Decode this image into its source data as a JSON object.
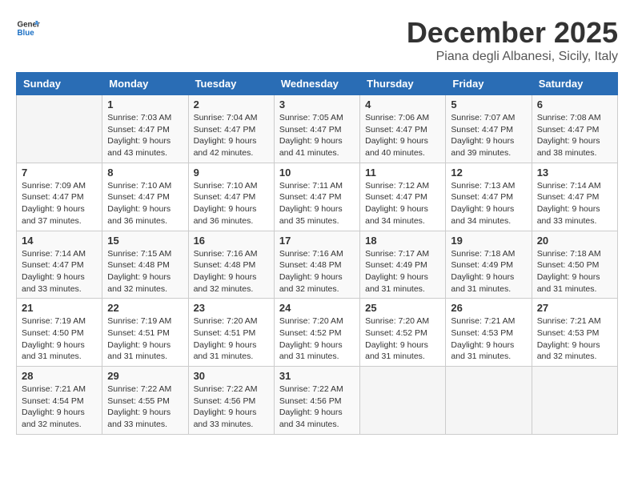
{
  "header": {
    "logo_line1": "General",
    "logo_line2": "Blue",
    "month_year": "December 2025",
    "location": "Piana degli Albanesi, Sicily, Italy"
  },
  "weekdays": [
    "Sunday",
    "Monday",
    "Tuesday",
    "Wednesday",
    "Thursday",
    "Friday",
    "Saturday"
  ],
  "weeks": [
    [
      {
        "day": "",
        "sunrise": "",
        "sunset": "",
        "daylight": ""
      },
      {
        "day": "1",
        "sunrise": "Sunrise: 7:03 AM",
        "sunset": "Sunset: 4:47 PM",
        "daylight": "Daylight: 9 hours and 43 minutes."
      },
      {
        "day": "2",
        "sunrise": "Sunrise: 7:04 AM",
        "sunset": "Sunset: 4:47 PM",
        "daylight": "Daylight: 9 hours and 42 minutes."
      },
      {
        "day": "3",
        "sunrise": "Sunrise: 7:05 AM",
        "sunset": "Sunset: 4:47 PM",
        "daylight": "Daylight: 9 hours and 41 minutes."
      },
      {
        "day": "4",
        "sunrise": "Sunrise: 7:06 AM",
        "sunset": "Sunset: 4:47 PM",
        "daylight": "Daylight: 9 hours and 40 minutes."
      },
      {
        "day": "5",
        "sunrise": "Sunrise: 7:07 AM",
        "sunset": "Sunset: 4:47 PM",
        "daylight": "Daylight: 9 hours and 39 minutes."
      },
      {
        "day": "6",
        "sunrise": "Sunrise: 7:08 AM",
        "sunset": "Sunset: 4:47 PM",
        "daylight": "Daylight: 9 hours and 38 minutes."
      }
    ],
    [
      {
        "day": "7",
        "sunrise": "Sunrise: 7:09 AM",
        "sunset": "Sunset: 4:47 PM",
        "daylight": "Daylight: 9 hours and 37 minutes."
      },
      {
        "day": "8",
        "sunrise": "Sunrise: 7:10 AM",
        "sunset": "Sunset: 4:47 PM",
        "daylight": "Daylight: 9 hours and 36 minutes."
      },
      {
        "day": "9",
        "sunrise": "Sunrise: 7:10 AM",
        "sunset": "Sunset: 4:47 PM",
        "daylight": "Daylight: 9 hours and 36 minutes."
      },
      {
        "day": "10",
        "sunrise": "Sunrise: 7:11 AM",
        "sunset": "Sunset: 4:47 PM",
        "daylight": "Daylight: 9 hours and 35 minutes."
      },
      {
        "day": "11",
        "sunrise": "Sunrise: 7:12 AM",
        "sunset": "Sunset: 4:47 PM",
        "daylight": "Daylight: 9 hours and 34 minutes."
      },
      {
        "day": "12",
        "sunrise": "Sunrise: 7:13 AM",
        "sunset": "Sunset: 4:47 PM",
        "daylight": "Daylight: 9 hours and 34 minutes."
      },
      {
        "day": "13",
        "sunrise": "Sunrise: 7:14 AM",
        "sunset": "Sunset: 4:47 PM",
        "daylight": "Daylight: 9 hours and 33 minutes."
      }
    ],
    [
      {
        "day": "14",
        "sunrise": "Sunrise: 7:14 AM",
        "sunset": "Sunset: 4:47 PM",
        "daylight": "Daylight: 9 hours and 33 minutes."
      },
      {
        "day": "15",
        "sunrise": "Sunrise: 7:15 AM",
        "sunset": "Sunset: 4:48 PM",
        "daylight": "Daylight: 9 hours and 32 minutes."
      },
      {
        "day": "16",
        "sunrise": "Sunrise: 7:16 AM",
        "sunset": "Sunset: 4:48 PM",
        "daylight": "Daylight: 9 hours and 32 minutes."
      },
      {
        "day": "17",
        "sunrise": "Sunrise: 7:16 AM",
        "sunset": "Sunset: 4:48 PM",
        "daylight": "Daylight: 9 hours and 32 minutes."
      },
      {
        "day": "18",
        "sunrise": "Sunrise: 7:17 AM",
        "sunset": "Sunset: 4:49 PM",
        "daylight": "Daylight: 9 hours and 31 minutes."
      },
      {
        "day": "19",
        "sunrise": "Sunrise: 7:18 AM",
        "sunset": "Sunset: 4:49 PM",
        "daylight": "Daylight: 9 hours and 31 minutes."
      },
      {
        "day": "20",
        "sunrise": "Sunrise: 7:18 AM",
        "sunset": "Sunset: 4:50 PM",
        "daylight": "Daylight: 9 hours and 31 minutes."
      }
    ],
    [
      {
        "day": "21",
        "sunrise": "Sunrise: 7:19 AM",
        "sunset": "Sunset: 4:50 PM",
        "daylight": "Daylight: 9 hours and 31 minutes."
      },
      {
        "day": "22",
        "sunrise": "Sunrise: 7:19 AM",
        "sunset": "Sunset: 4:51 PM",
        "daylight": "Daylight: 9 hours and 31 minutes."
      },
      {
        "day": "23",
        "sunrise": "Sunrise: 7:20 AM",
        "sunset": "Sunset: 4:51 PM",
        "daylight": "Daylight: 9 hours and 31 minutes."
      },
      {
        "day": "24",
        "sunrise": "Sunrise: 7:20 AM",
        "sunset": "Sunset: 4:52 PM",
        "daylight": "Daylight: 9 hours and 31 minutes."
      },
      {
        "day": "25",
        "sunrise": "Sunrise: 7:20 AM",
        "sunset": "Sunset: 4:52 PM",
        "daylight": "Daylight: 9 hours and 31 minutes."
      },
      {
        "day": "26",
        "sunrise": "Sunrise: 7:21 AM",
        "sunset": "Sunset: 4:53 PM",
        "daylight": "Daylight: 9 hours and 31 minutes."
      },
      {
        "day": "27",
        "sunrise": "Sunrise: 7:21 AM",
        "sunset": "Sunset: 4:53 PM",
        "daylight": "Daylight: 9 hours and 32 minutes."
      }
    ],
    [
      {
        "day": "28",
        "sunrise": "Sunrise: 7:21 AM",
        "sunset": "Sunset: 4:54 PM",
        "daylight": "Daylight: 9 hours and 32 minutes."
      },
      {
        "day": "29",
        "sunrise": "Sunrise: 7:22 AM",
        "sunset": "Sunset: 4:55 PM",
        "daylight": "Daylight: 9 hours and 33 minutes."
      },
      {
        "day": "30",
        "sunrise": "Sunrise: 7:22 AM",
        "sunset": "Sunset: 4:56 PM",
        "daylight": "Daylight: 9 hours and 33 minutes."
      },
      {
        "day": "31",
        "sunrise": "Sunrise: 7:22 AM",
        "sunset": "Sunset: 4:56 PM",
        "daylight": "Daylight: 9 hours and 34 minutes."
      },
      {
        "day": "",
        "sunrise": "",
        "sunset": "",
        "daylight": ""
      },
      {
        "day": "",
        "sunrise": "",
        "sunset": "",
        "daylight": ""
      },
      {
        "day": "",
        "sunrise": "",
        "sunset": "",
        "daylight": ""
      }
    ]
  ]
}
